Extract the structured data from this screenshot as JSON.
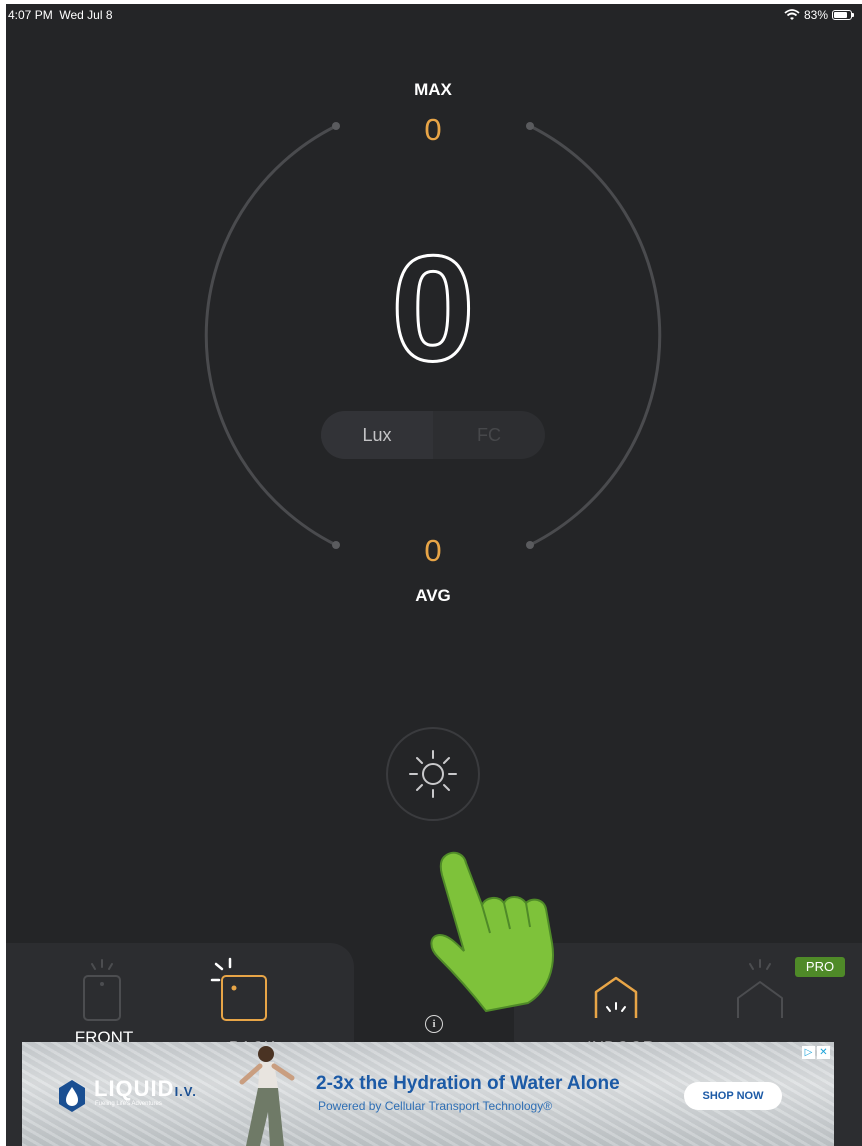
{
  "status_bar": {
    "time": "4:07 PM",
    "date": "Wed Jul 8",
    "battery": "83%",
    "battery_level": 0.83
  },
  "meter": {
    "max_label": "MAX",
    "max_value": "0",
    "current_value": "0",
    "avg_label": "AVG",
    "avg_value": "0",
    "unit_options": [
      "Lux",
      "FC"
    ],
    "selected_unit": "Lux"
  },
  "sensor_tabs": {
    "front": "FRONT",
    "back": "BACK",
    "selected": "BACK"
  },
  "mode_tabs": {
    "indoor": "INDOOR",
    "outdoor": "OUTDOOR",
    "pro_badge": "PRO",
    "selected": "INDOOR"
  },
  "info_symbol": "i",
  "ad": {
    "brand": "LIQUID I.V.",
    "brand_main": "LIQUID",
    "brand_accent": "I.V.",
    "tagline": "Fueling Life's Adventures",
    "headline": "2-3x the Hydration of Water Alone",
    "subline": "Powered by Cellular Transport Technology®",
    "cta": "SHOP NOW"
  },
  "colors": {
    "background": "#242527",
    "accent": "#e8a547",
    "pro_badge": "#4f8a28",
    "hand": "#7ec23a",
    "ad_text": "#1c5aa6"
  },
  "icons": [
    "wifi-icon",
    "battery-icon",
    "sun-icon",
    "front-camera-icon",
    "back-camera-icon",
    "indoor-icon",
    "outdoor-icon",
    "info-icon",
    "tap-hand-icon",
    "adchoices-icon",
    "close-ad-icon"
  ]
}
